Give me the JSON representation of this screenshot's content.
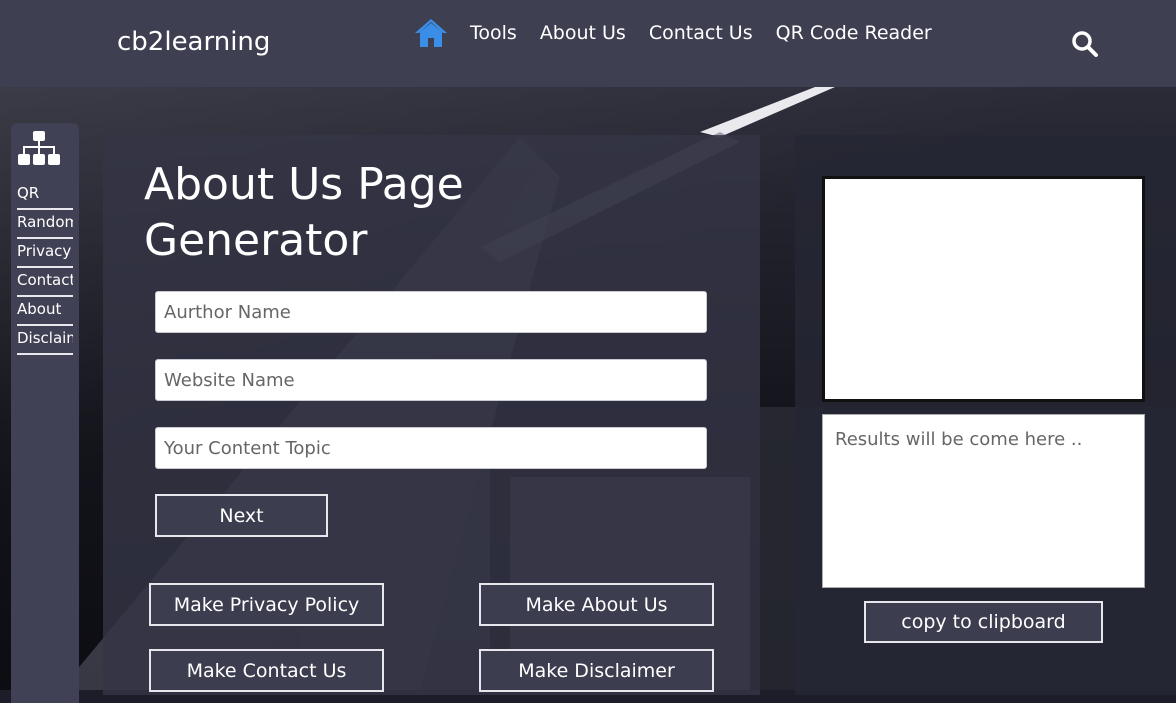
{
  "header": {
    "brand": "cb2learning",
    "nav": [
      "Tools",
      "About Us",
      "Contact Us",
      "QR Code Reader"
    ]
  },
  "sidebar": {
    "links": [
      "QR",
      "Random",
      "Privacy",
      "Contact",
      "About",
      "Disclaimer"
    ]
  },
  "main": {
    "title": "About Us Page Generator",
    "fields": {
      "author_placeholder": "Aurthor Name",
      "website_placeholder": "Website Name",
      "topic_placeholder": "Your Content Topic"
    },
    "next_label": "Next",
    "buttons": {
      "privacy": "Make Privacy Policy",
      "about": "Make About Us",
      "contact": "Make Contact Us",
      "disclaimer": "Make Disclaimer"
    }
  },
  "right": {
    "results_placeholder": "Results will be come here ..",
    "copy_label": "copy to clipboard"
  },
  "colors": {
    "header_bg": "#3e3f51",
    "home_icon": "#3b8ee8",
    "button_bg": "#3c3d4e"
  }
}
